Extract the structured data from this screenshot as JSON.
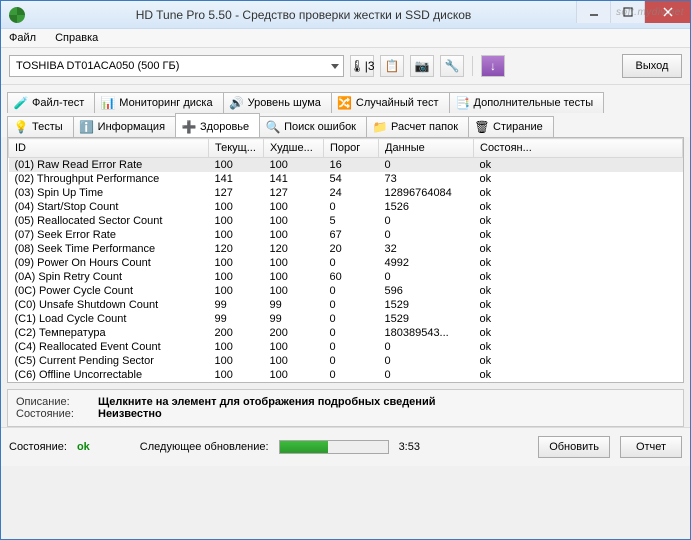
{
  "window": {
    "title": "HD Tune Pro 5.50 - Средство проверки жестки и SSD дисков"
  },
  "menu": {
    "file": "Файл",
    "help": "Справка"
  },
  "toolbar": {
    "drive": "TOSHIBA DT01ACA050 (500 ГБ)",
    "temp_indicator": "|3",
    "exit": "Выход"
  },
  "tabs_row1": [
    {
      "icon": "file-test-icon",
      "label": "Файл-тест"
    },
    {
      "icon": "monitor-icon",
      "label": "Мониторинг диска"
    },
    {
      "icon": "speaker-icon",
      "label": "Уровень шума"
    },
    {
      "icon": "random-icon",
      "label": "Случайный тест"
    },
    {
      "icon": "extra-icon",
      "label": "Дополнительные тесты"
    }
  ],
  "tabs_row2": [
    {
      "icon": "bulb-icon",
      "label": "Тесты"
    },
    {
      "icon": "info-icon",
      "label": "Информация"
    },
    {
      "icon": "health-icon",
      "label": "Здоровье",
      "active": true
    },
    {
      "icon": "search-icon",
      "label": "Поиск ошибок"
    },
    {
      "icon": "folder-icon",
      "label": "Расчет папок"
    },
    {
      "icon": "erase-icon",
      "label": "Стирание"
    }
  ],
  "columns": [
    "ID",
    "Текущ...",
    "Худше...",
    "Порог",
    "Данные",
    "Состоян..."
  ],
  "rows": [
    {
      "id": "(01) Raw Read Error Rate",
      "cur": "100",
      "worst": "100",
      "thr": "16",
      "data": "0",
      "status": "ok"
    },
    {
      "id": "(02) Throughput Performance",
      "cur": "141",
      "worst": "141",
      "thr": "54",
      "data": "73",
      "status": "ok"
    },
    {
      "id": "(03) Spin Up Time",
      "cur": "127",
      "worst": "127",
      "thr": "24",
      "data": "12896764084",
      "status": "ok"
    },
    {
      "id": "(04) Start/Stop Count",
      "cur": "100",
      "worst": "100",
      "thr": "0",
      "data": "1526",
      "status": "ok"
    },
    {
      "id": "(05) Reallocated Sector Count",
      "cur": "100",
      "worst": "100",
      "thr": "5",
      "data": "0",
      "status": "ok"
    },
    {
      "id": "(07) Seek Error Rate",
      "cur": "100",
      "worst": "100",
      "thr": "67",
      "data": "0",
      "status": "ok"
    },
    {
      "id": "(08) Seek Time Performance",
      "cur": "120",
      "worst": "120",
      "thr": "20",
      "data": "32",
      "status": "ok"
    },
    {
      "id": "(09) Power On Hours Count",
      "cur": "100",
      "worst": "100",
      "thr": "0",
      "data": "4992",
      "status": "ok"
    },
    {
      "id": "(0A) Spin Retry Count",
      "cur": "100",
      "worst": "100",
      "thr": "60",
      "data": "0",
      "status": "ok"
    },
    {
      "id": "(0C) Power Cycle Count",
      "cur": "100",
      "worst": "100",
      "thr": "0",
      "data": "596",
      "status": "ok"
    },
    {
      "id": "(C0) Unsafe Shutdown Count",
      "cur": "99",
      "worst": "99",
      "thr": "0",
      "data": "1529",
      "status": "ok"
    },
    {
      "id": "(C1) Load Cycle Count",
      "cur": "99",
      "worst": "99",
      "thr": "0",
      "data": "1529",
      "status": "ok"
    },
    {
      "id": "(C2) Температура",
      "cur": "200",
      "worst": "200",
      "thr": "0",
      "data": "180389543...",
      "status": "ok"
    },
    {
      "id": "(C4) Reallocated Event Count",
      "cur": "100",
      "worst": "100",
      "thr": "0",
      "data": "0",
      "status": "ok"
    },
    {
      "id": "(C5) Current Pending Sector",
      "cur": "100",
      "worst": "100",
      "thr": "0",
      "data": "0",
      "status": "ok"
    },
    {
      "id": "(C6) Offline Uncorrectable",
      "cur": "100",
      "worst": "100",
      "thr": "0",
      "data": "0",
      "status": "ok"
    }
  ],
  "details": {
    "desc_label": "Описание:",
    "desc_value": "Щелкните на элемент для отображения подробных сведений",
    "state_label": "Состояние:",
    "state_value": "Неизвестно"
  },
  "status": {
    "state_label": "Состояние:",
    "state_value": "ok",
    "next_label": "Следующее обновление:",
    "time": "3:53",
    "refresh": "Обновить",
    "report": "Отчет"
  },
  "watermark": "soft.mydiv.net"
}
